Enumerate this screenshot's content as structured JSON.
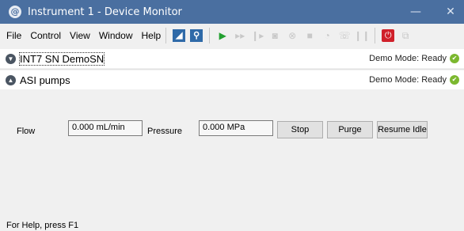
{
  "window": {
    "title": "Instrument 1 - Device Monitor",
    "controls": {
      "minimize": "—",
      "close": "✕"
    }
  },
  "menu": [
    "File",
    "Control",
    "View",
    "Window",
    "Help"
  ],
  "toolbar_icons": [
    "device-settings-icon",
    "sample-icon",
    "play-icon",
    "fast-forward-icon",
    "step-icon",
    "camera-icon",
    "cancel-icon",
    "stop-icon",
    "pressure-icon",
    "phone-icon",
    "pause-icon",
    "power-icon",
    "network-icon"
  ],
  "devices": [
    {
      "name": "INT7 SN DemoSN",
      "status": "Demo Mode: Ready",
      "expanded": false
    },
    {
      "name": "ASI pumps",
      "status": "Demo Mode: Ready",
      "expanded": true
    }
  ],
  "pump_panel": {
    "flow_label": "Flow",
    "flow_value": "0.000 mL/min",
    "pressure_label": "Pressure",
    "pressure_value": "0.000 MPa",
    "stop_label": "Stop",
    "purge_label": "Purge",
    "resume_idle_label": "Resume Idle"
  },
  "statusbar": {
    "text": "For Help, press F1"
  },
  "colors": {
    "titlebar": "#4a6fa0",
    "ready": "#7cb82f",
    "power": "#d0202a"
  }
}
